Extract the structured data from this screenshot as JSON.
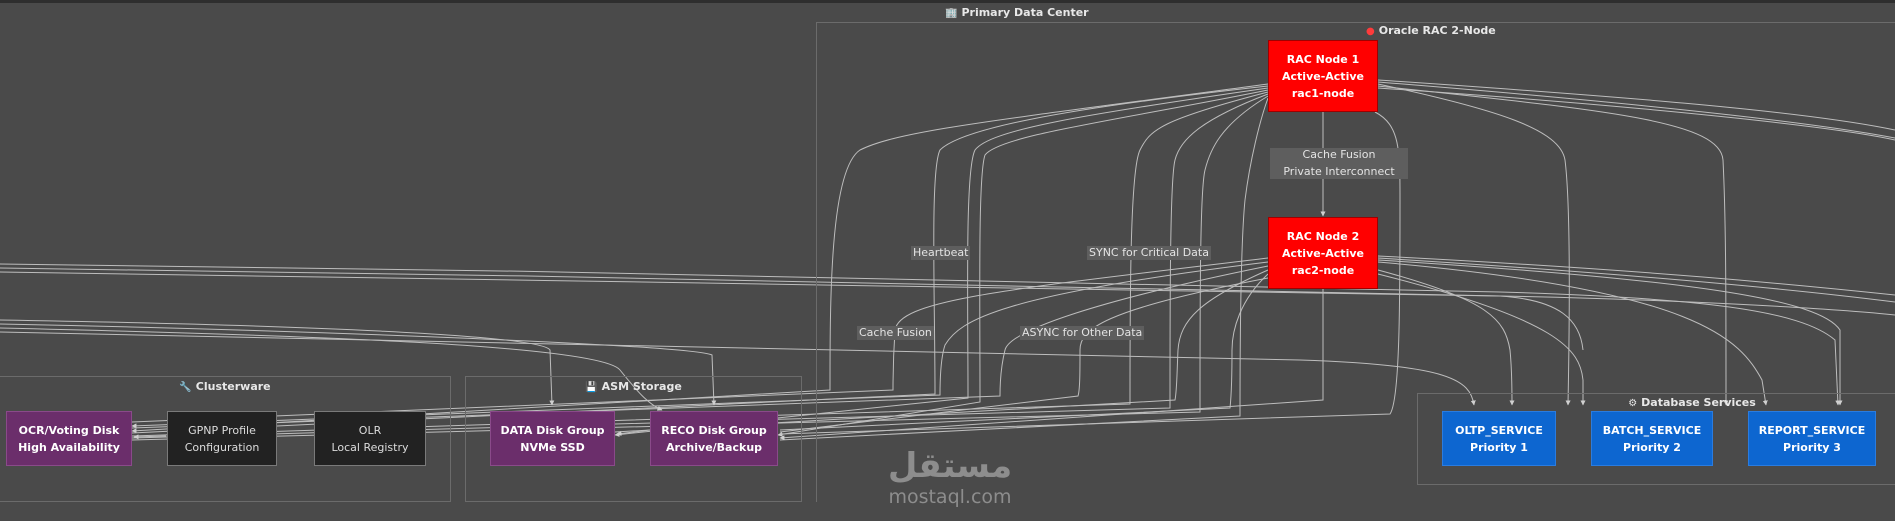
{
  "clusters": {
    "primary": {
      "title": "Primary Data Center",
      "icon": "building-icon"
    },
    "rac": {
      "title": "Oracle RAC 2-Node",
      "icon": "red-circle-icon"
    },
    "clusterware": {
      "title": "Clusterware",
      "icon": "wrench-icon"
    },
    "asm": {
      "title": "ASM Storage",
      "icon": "floppy-disk-icon"
    },
    "services": {
      "title": "Database Services",
      "icon": "gear-icon"
    }
  },
  "nodes": {
    "rac1": {
      "line1": "RAC Node 1",
      "line2": "Active-Active",
      "line3": "rac1-node"
    },
    "rac2": {
      "line1": "RAC Node 2",
      "line2": "Active-Active",
      "line3": "rac2-node"
    },
    "ocr": {
      "line1": "OCR/Voting Disk",
      "line2": "High Availability"
    },
    "gpnp": {
      "line1": "GPNP Profile",
      "line2": "Configuration"
    },
    "olr": {
      "line1": "OLR",
      "line2": "Local Registry"
    },
    "data": {
      "line1": "DATA Disk Group",
      "line2": "NVMe SSD"
    },
    "reco": {
      "line1": "RECO Disk Group",
      "line2": "Archive/Backup"
    },
    "oltp": {
      "line1": "OLTP_SERVICE",
      "line2": "Priority 1"
    },
    "batch": {
      "line1": "BATCH_SERVICE",
      "line2": "Priority 2"
    },
    "report": {
      "line1": "REPORT_SERVICE",
      "line2": "Priority 3"
    }
  },
  "edge_labels": {
    "cache_fusion_1": "Cache Fusion",
    "cache_fusion_2": "Private Interconnect",
    "heartbeat": "Heartbeat",
    "sync": "SYNC for Critical Data",
    "cache_fusion": "Cache Fusion",
    "async": "ASYNC for Other Data"
  },
  "watermark": {
    "arabic": "مستقل",
    "latin": "mostaql.com"
  },
  "colors": {
    "background": "#4a4a4a",
    "rac_node": "#ff0000",
    "storage_node": "#6b2e6b",
    "clusterware_node": "#222222",
    "service_node": "#0d66d0",
    "edge": "#c8c8c8"
  }
}
